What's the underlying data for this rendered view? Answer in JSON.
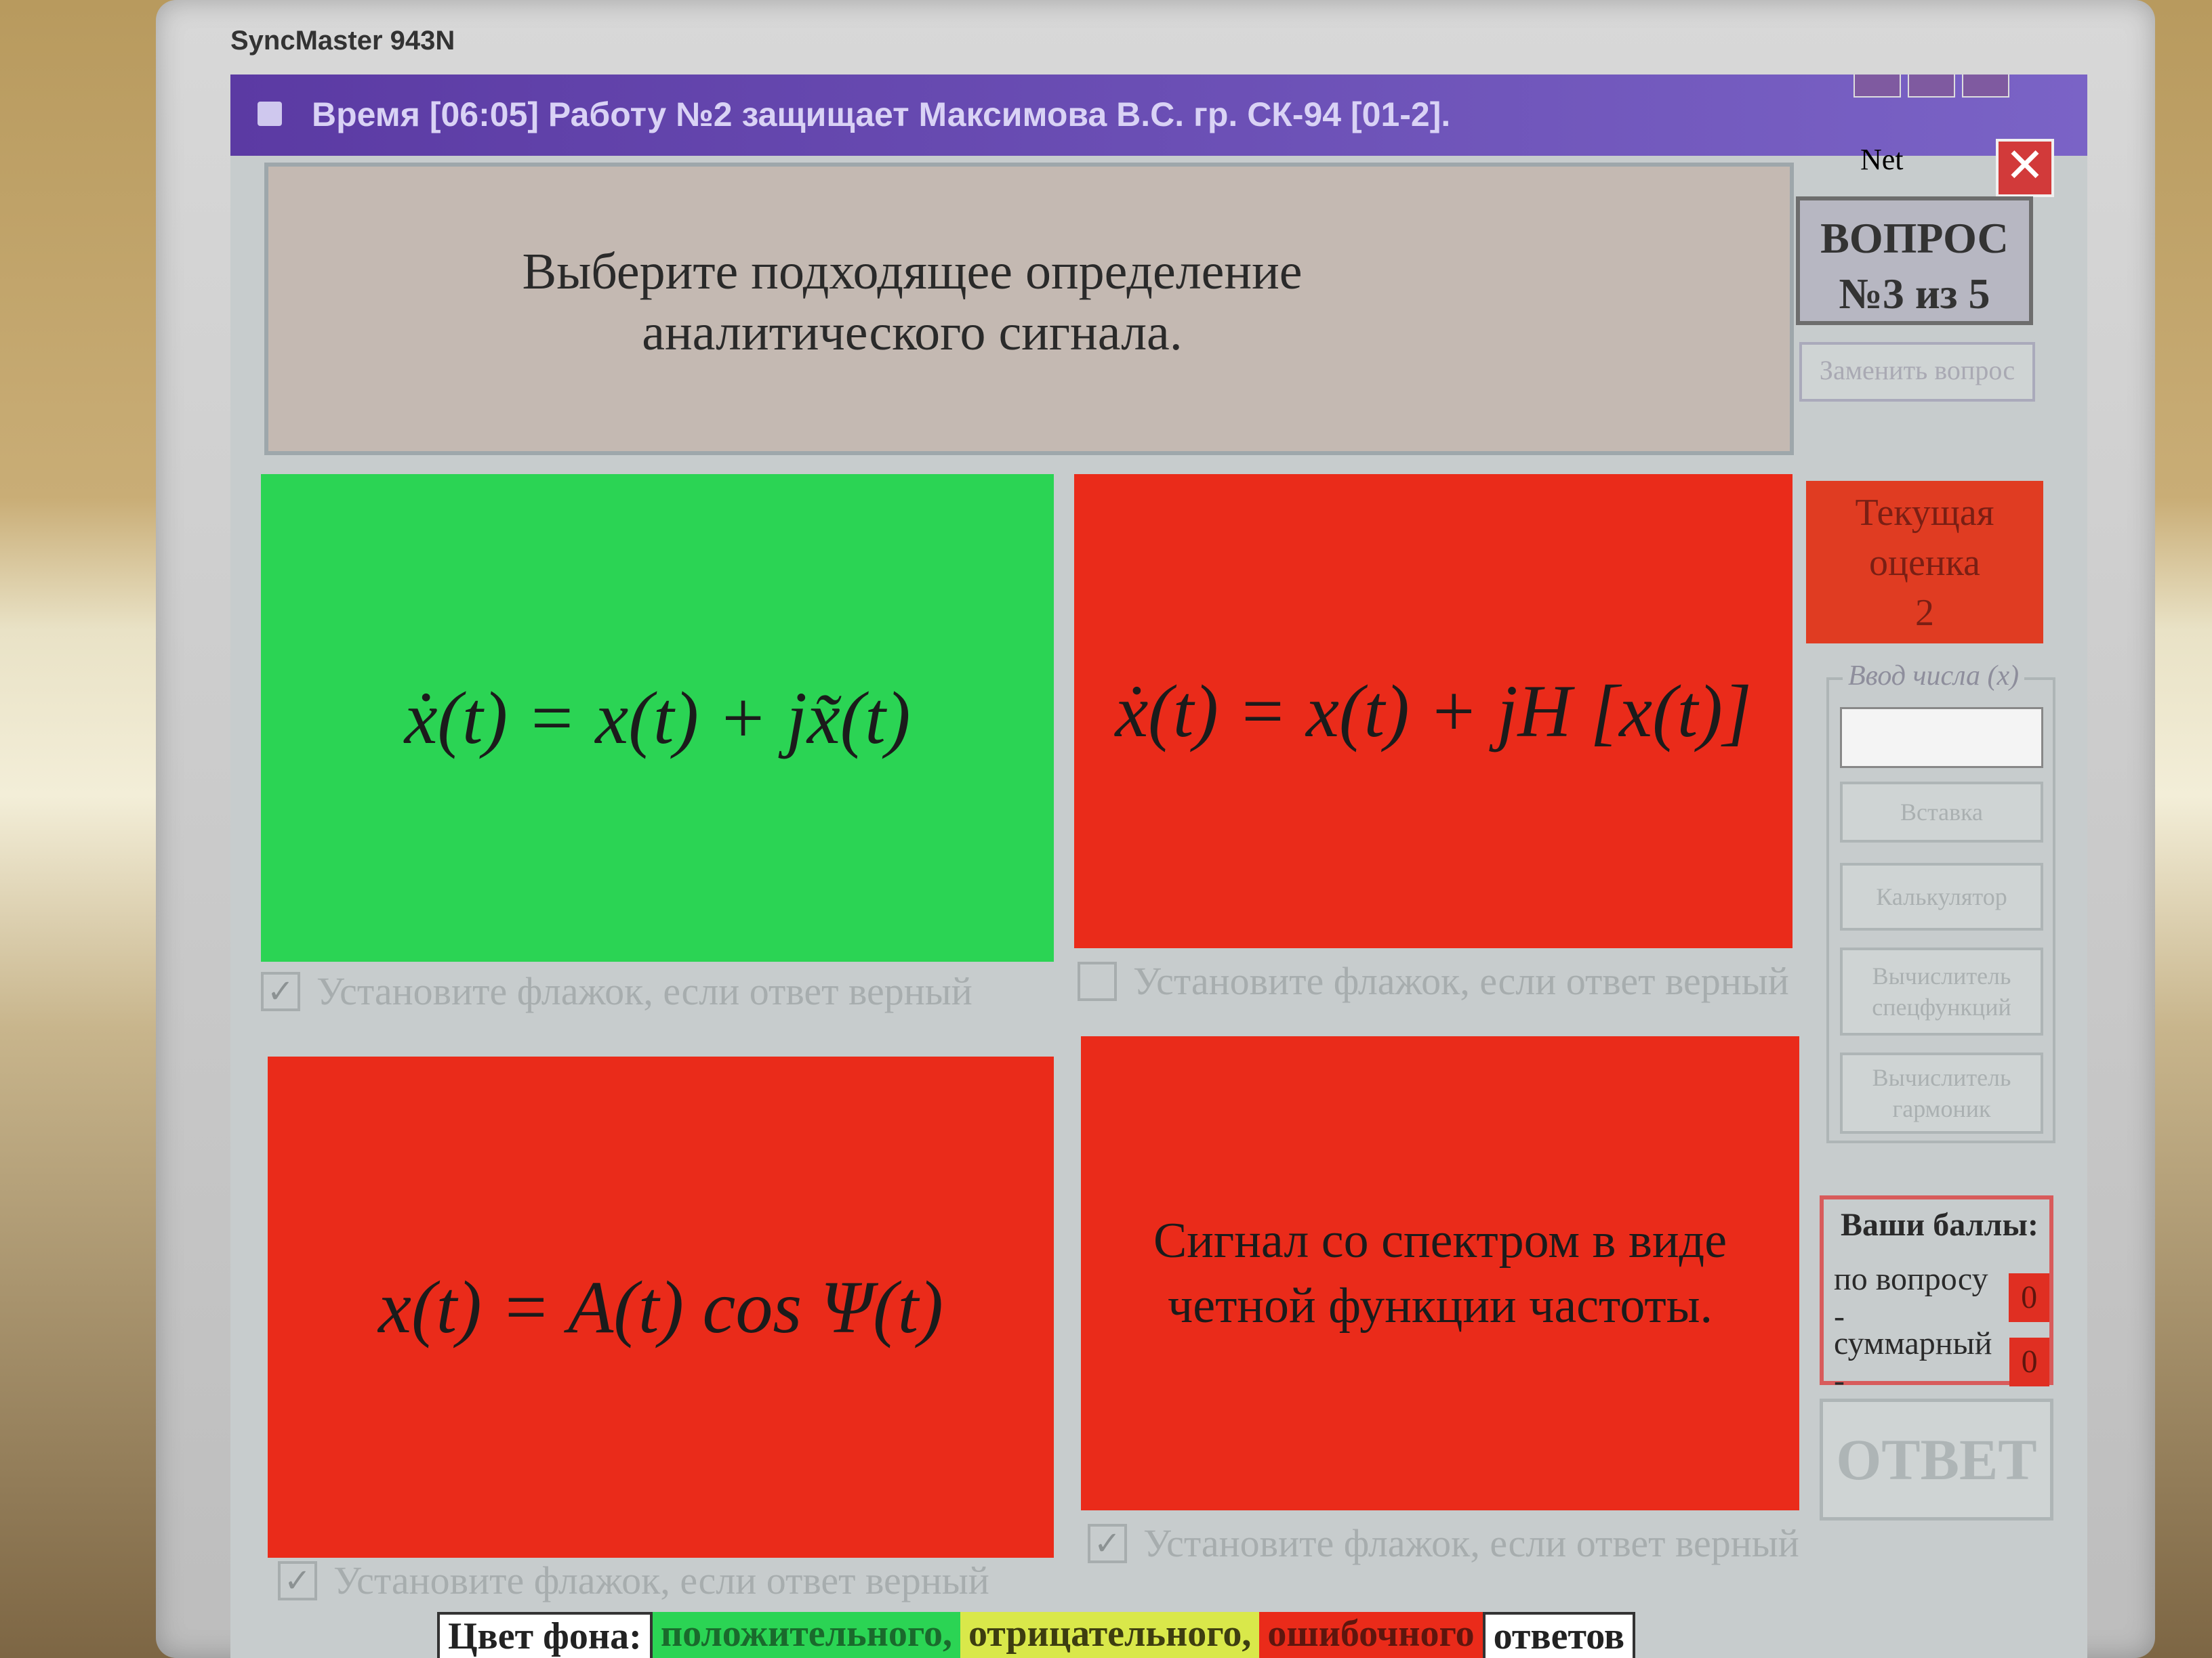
{
  "monitor": {
    "brand": "SyncMaster 943N"
  },
  "window": {
    "title": "Время [06:05] Работу №2 защищает Максимова В.С.  гр. СК-94 [01-2].",
    "net_label": "Net",
    "close_label": "✕"
  },
  "question": {
    "text": "Выберите подходящее определение аналитического сигнала.",
    "counter_line1": "ВОПРОС",
    "counter_line2": "№3 из 5",
    "replace_label": "Заменить вопрос"
  },
  "answers": [
    {
      "formula": "ẋ(t) = x(t) + jx̃(t)",
      "checkbox_label": "Установите флажок, если ответ верный",
      "checked": true,
      "color": "#2bd454"
    },
    {
      "formula": "ẋ(t) = x(t) + jH [x(t)]",
      "checkbox_label": "Установите флажок, если ответ верный",
      "checked": false,
      "color": "#ea2b1a"
    },
    {
      "formula": "x(t) = A(t) cos Ψ(t)",
      "checkbox_label": "Установите флажок, если ответ верный",
      "checked": true,
      "color": "#ea2b1a"
    },
    {
      "text": "Сигнал со спектром в виде четной функции частоты.",
      "checkbox_label": "Установите флажок, если ответ верный",
      "checked": true,
      "color": "#ea2b1a"
    }
  ],
  "grade": {
    "line1": "Текущая",
    "line2": "оценка",
    "value": "2"
  },
  "input_panel": {
    "legend": "Ввод числа (x)",
    "value": "",
    "insert": "Вставка",
    "calculator": "Калькулятор",
    "special_functions": "Вычислитель спецфункций",
    "harmonics": "Вычислитель гармоник"
  },
  "scores": {
    "header": "Ваши баллы:",
    "per_question_label": "по вопросу -",
    "per_question_value": "0",
    "total_label": "суммарный -",
    "total_value": "0"
  },
  "answer_button": "ОТВЕТ",
  "legend": {
    "prefix": "Цвет фона:",
    "positive": "положительного,",
    "negative": "отрицательного,",
    "wrong": "ошибочного",
    "suffix": "ответов"
  }
}
